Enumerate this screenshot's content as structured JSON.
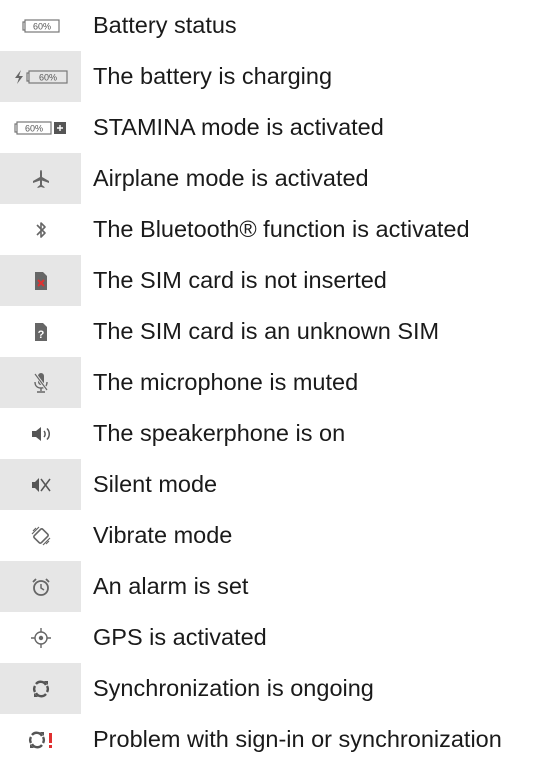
{
  "items": [
    {
      "icon": "battery-status-icon",
      "icon_text": "60%",
      "label": "Battery status"
    },
    {
      "icon": "battery-charging-icon",
      "icon_text": "60%",
      "label": "The battery is charging"
    },
    {
      "icon": "battery-stamina-icon",
      "icon_text": "60%",
      "label": "STAMINA mode is activated"
    },
    {
      "icon": "airplane-icon",
      "label": "Airplane mode is activated"
    },
    {
      "icon": "bluetooth-icon",
      "label": "The Bluetooth® function is activated"
    },
    {
      "icon": "sim-not-inserted-icon",
      "label": "The SIM card is not inserted"
    },
    {
      "icon": "sim-unknown-icon",
      "label": "The SIM card is an unknown SIM"
    },
    {
      "icon": "microphone-muted-icon",
      "label": "The microphone is muted"
    },
    {
      "icon": "speakerphone-icon",
      "label": "The speakerphone is on"
    },
    {
      "icon": "silent-mode-icon",
      "label": "Silent mode"
    },
    {
      "icon": "vibrate-mode-icon",
      "label": "Vibrate mode"
    },
    {
      "icon": "alarm-icon",
      "label": "An alarm is set"
    },
    {
      "icon": "gps-icon",
      "label": "GPS is activated"
    },
    {
      "icon": "sync-icon",
      "label": "Synchronization is ongoing"
    },
    {
      "icon": "sync-problem-icon",
      "label": "Problem with sign-in or synchronization"
    }
  ],
  "colors": {
    "shade": "#e6e6e6",
    "icon_gray": "#777777",
    "alert_red": "#e03030"
  }
}
